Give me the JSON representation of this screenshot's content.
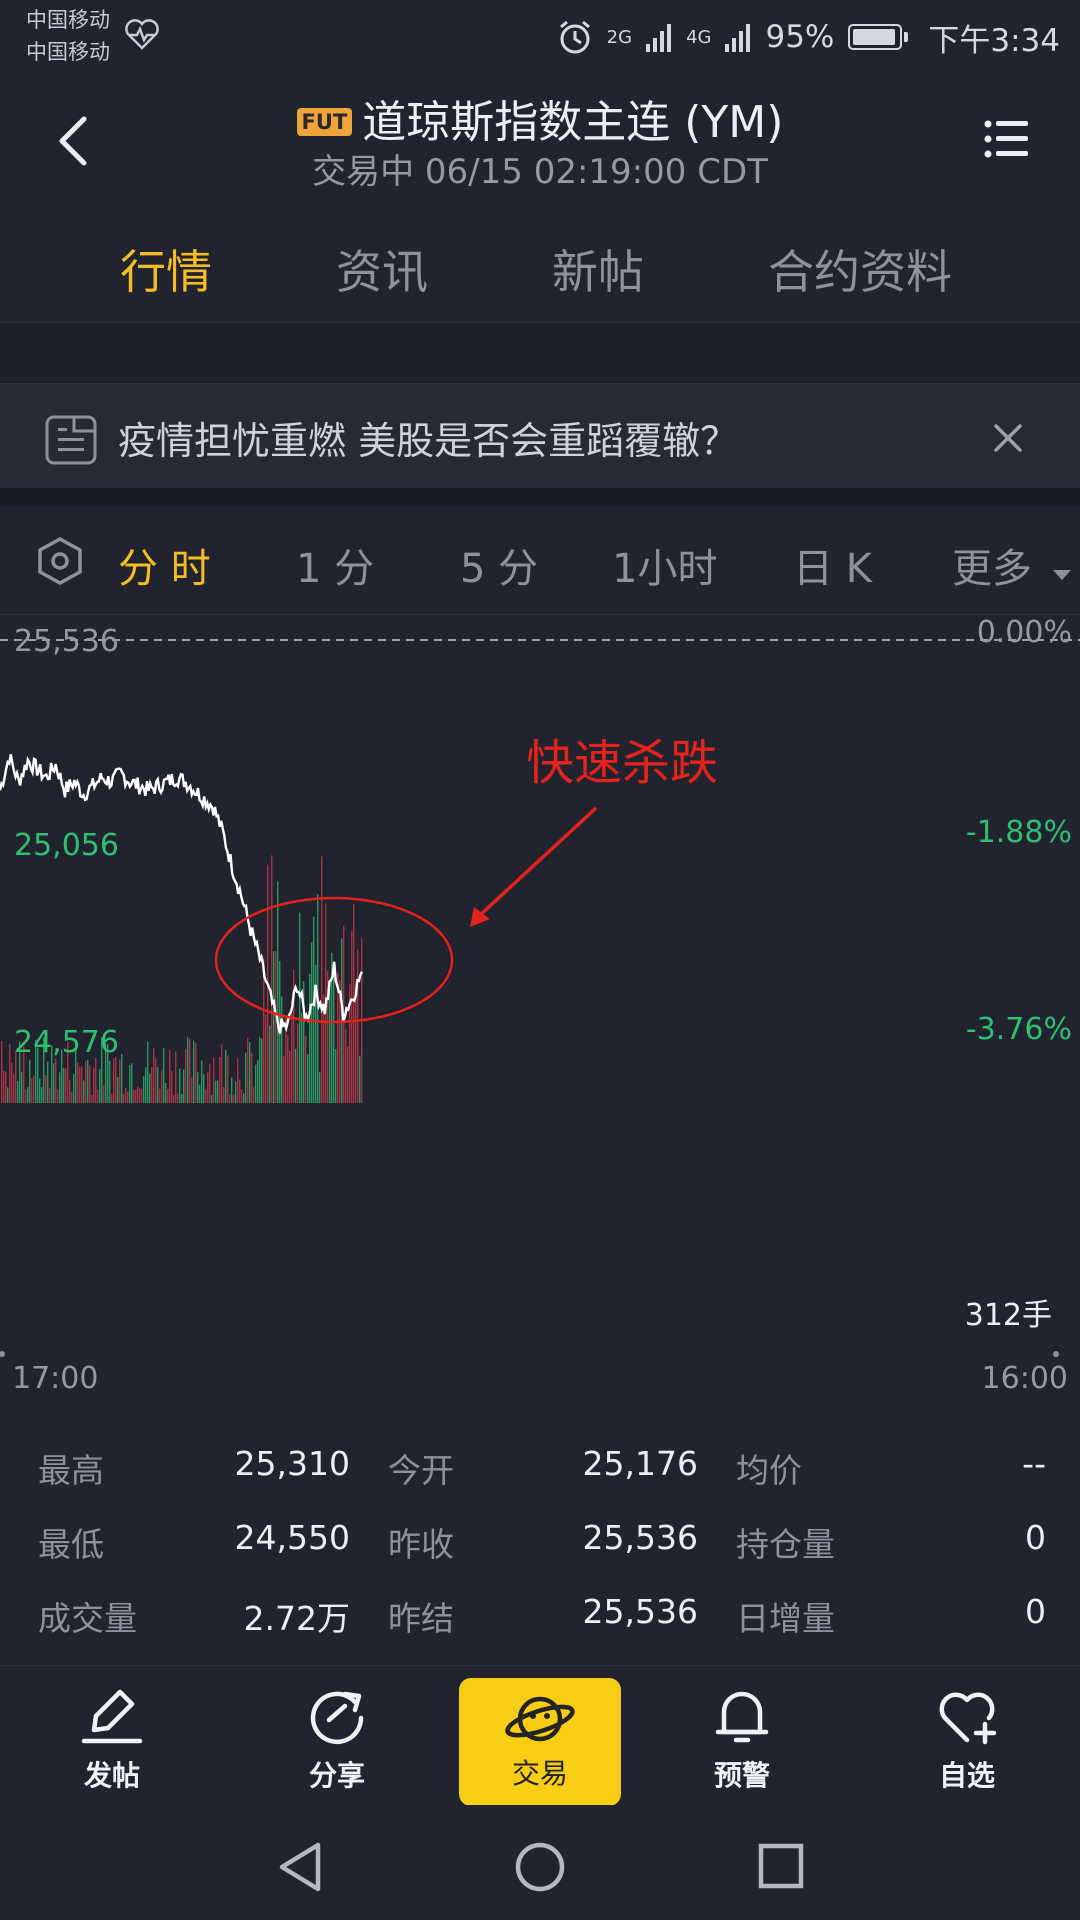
{
  "status_bar": {
    "carrier1": "中国移动",
    "carrier2": "中国移动",
    "net1": "2G",
    "net2": "4G",
    "battery": "95%",
    "battery_level": 0.95,
    "time": "下午3:34"
  },
  "header": {
    "badge": "FUT",
    "title": "道琼斯指数主连 (YM)",
    "subtitle": "交易中 06/15 02:19:00 CDT"
  },
  "tabs": [
    "行情",
    "资讯",
    "新帖",
    "合约资料"
  ],
  "news": {
    "text": "疫情担忧重燃 美股是否会重蹈覆辙？"
  },
  "periods": [
    "分 时",
    "1 分",
    "5 分",
    "1小时",
    "日 K",
    "更多"
  ],
  "chart": {
    "price_top": "25,536",
    "price_mid": "25,056",
    "price_low": "24,576",
    "pct_top": "0.00%",
    "pct_mid": "-1.88%",
    "pct_low": "-3.76%",
    "volume_label": "312手",
    "time_start": "17:00",
    "time_end": "16:00",
    "annotation": "快速杀跌",
    "colors": {
      "line": "#ffffff",
      "up_green": "#2fbf71",
      "down_red": "#d23a4a",
      "annotation_red": "#e3231c"
    }
  },
  "chart_data": {
    "type": "line",
    "title": "",
    "xlabel": "",
    "ylabel": "",
    "x_range": [
      "17:00",
      "16:00"
    ],
    "ylim": [
      24576,
      25536
    ],
    "y_ticks": [
      25536,
      25056,
      24576
    ],
    "pct_ticks": [
      "0.00%",
      "-1.88%",
      "-3.76%"
    ],
    "series": [
      {
        "values": [
          25180,
          25260,
          25200,
          25250,
          25230,
          25210,
          25240,
          25180,
          25200,
          25170,
          25190,
          25210,
          25200,
          25220,
          25200,
          25190,
          25180,
          25190,
          25200,
          25210,
          25200,
          25180,
          25160,
          25140,
          25080,
          25000,
          24930,
          24850,
          24780,
          24700,
          24620,
          24620,
          24720,
          24640,
          24700,
          24660,
          24760,
          24650,
          24690,
          24750
        ]
      }
    ]
  },
  "stats": [
    {
      "label": "最高",
      "value": "25,310"
    },
    {
      "label": "今开",
      "value": "25,176"
    },
    {
      "label": "均价",
      "value": "--"
    },
    {
      "label": "最低",
      "value": "24,550"
    },
    {
      "label": "昨收",
      "value": "25,536"
    },
    {
      "label": "持仓量",
      "value": "0"
    },
    {
      "label": "成交量",
      "value": "2.72万"
    },
    {
      "label": "昨结",
      "value": "25,536"
    },
    {
      "label": "日增量",
      "value": "0"
    }
  ],
  "bottom_nav": [
    "发帖",
    "分享",
    "交易",
    "预警",
    "自选"
  ]
}
